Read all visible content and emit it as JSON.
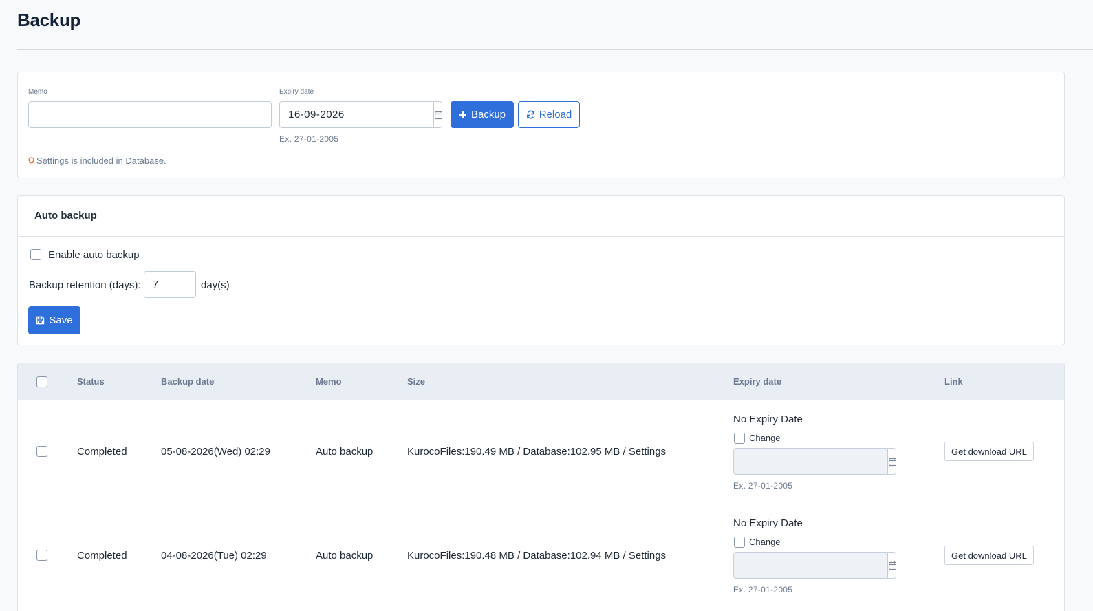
{
  "page": {
    "title": "Backup"
  },
  "backup_form": {
    "memo_label": "Memo",
    "memo_value": "",
    "expiry_label": "Expiry date",
    "expiry_value": "16-09-2026",
    "expiry_hint": "Ex. 27-01-2005",
    "backup_button": "Backup",
    "reload_button": "Reload",
    "note": "Settings is included in Database."
  },
  "auto_backup": {
    "title": "Auto backup",
    "enable_label": "Enable auto backup",
    "enabled": false,
    "retention_label": "Backup retention (days):",
    "retention_value": "7",
    "retention_unit": "day(s)",
    "save_button": "Save"
  },
  "table": {
    "columns": [
      "Status",
      "Backup date",
      "Memo",
      "Size",
      "Expiry date",
      "Link"
    ],
    "rows": [
      {
        "status": "Completed",
        "backup_date": "05-08-2026(Wed) 02:29",
        "memo": "Auto backup",
        "size": "KurocoFiles:190.49 MB / Database:102.95 MB / Settings",
        "expiry_text": "No Expiry Date",
        "change_label": "Change",
        "expiry_hint": "Ex. 27-01-2005",
        "link_button": "Get download URL"
      },
      {
        "status": "Completed",
        "backup_date": "04-08-2026(Tue) 02:29",
        "memo": "Auto backup",
        "size": "KurocoFiles:190.48 MB / Database:102.94 MB / Settings",
        "expiry_text": "No Expiry Date",
        "change_label": "Change",
        "expiry_hint": "Ex. 27-01-2005",
        "link_button": "Get download URL"
      }
    ]
  },
  "colors": {
    "primary": "#2f6fdb",
    "note_icon": "#f0703a",
    "header_bg": "#e9eef5"
  },
  "icons": [
    "calendar-icon",
    "plus-icon",
    "refresh-icon",
    "lightbulb-icon",
    "save-icon"
  ]
}
